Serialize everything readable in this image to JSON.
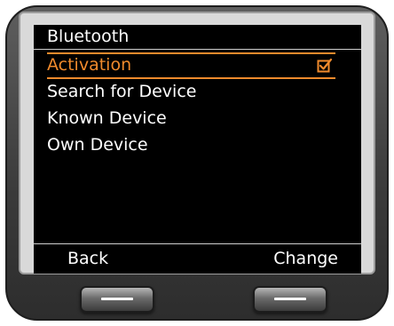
{
  "screen": {
    "title": "Bluetooth",
    "menu": [
      {
        "label": "Activation",
        "checked": true
      },
      {
        "label": "Search for Device"
      },
      {
        "label": "Known Device"
      },
      {
        "label": "Own Device"
      }
    ]
  },
  "softkeys": {
    "left": "Back",
    "right": "Change"
  },
  "colors": {
    "accent": "#f08a2c",
    "screen_bg": "#000000",
    "text": "#ffffff"
  },
  "icons": {
    "check": "checkbox-checked-icon",
    "hw_key": "dash-bar-icon"
  }
}
